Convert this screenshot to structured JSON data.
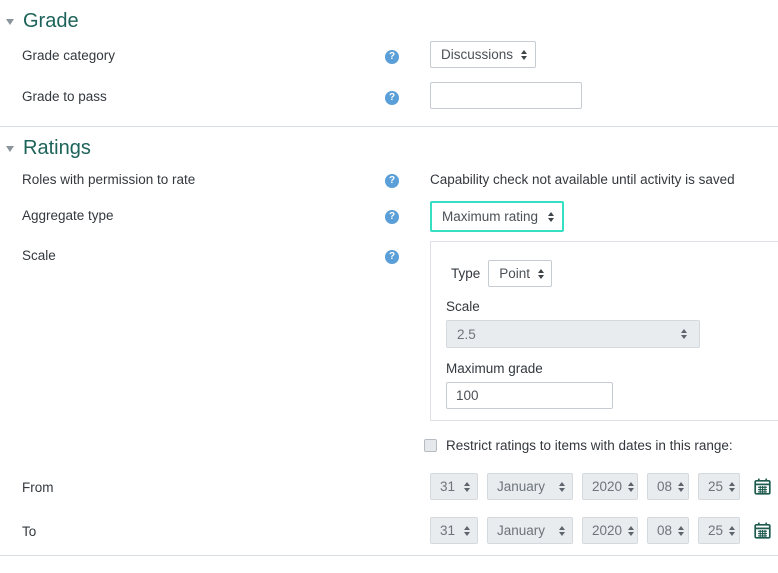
{
  "colors": {
    "section-title": "#1d635a",
    "focus-teal": "#35dfc3",
    "help-blue": "#5a9fd8",
    "control-border": "#c6ccd2",
    "box-border": "#dde1e6",
    "disabled-bg": "#e9ecef",
    "disabled-border": "#d4d9de",
    "text": "#33383e",
    "muted-text": "#6d747b",
    "divider": "#d9dee3",
    "calendar-green": "#1e5b4e",
    "caret-grey": "#8a949c"
  },
  "icons": {
    "help": "?"
  },
  "grade": {
    "title": "Grade",
    "category": {
      "label": "Grade category",
      "value": "Discussions"
    },
    "pass": {
      "label": "Grade to pass",
      "value": ""
    }
  },
  "ratings": {
    "title": "Ratings",
    "roles": {
      "label": "Roles with permission to rate",
      "status": "Capability check not available until activity is saved"
    },
    "aggregate": {
      "label": "Aggregate type",
      "value": "Maximum rating"
    },
    "scale": {
      "label": "Scale",
      "type_label": "Type",
      "type_value": "Point",
      "scale_label": "Scale",
      "scale_value": "2.5",
      "max_label": "Maximum grade",
      "max_value": "100"
    },
    "restrict_label": "Restrict ratings to items with dates in this range:",
    "restrict_checked": false,
    "from": {
      "label": "From",
      "day": "31",
      "month": "January",
      "year": "2020",
      "hour": "08",
      "minute": "25"
    },
    "to": {
      "label": "To",
      "day": "31",
      "month": "January",
      "year": "2020",
      "hour": "08",
      "minute": "25"
    }
  }
}
